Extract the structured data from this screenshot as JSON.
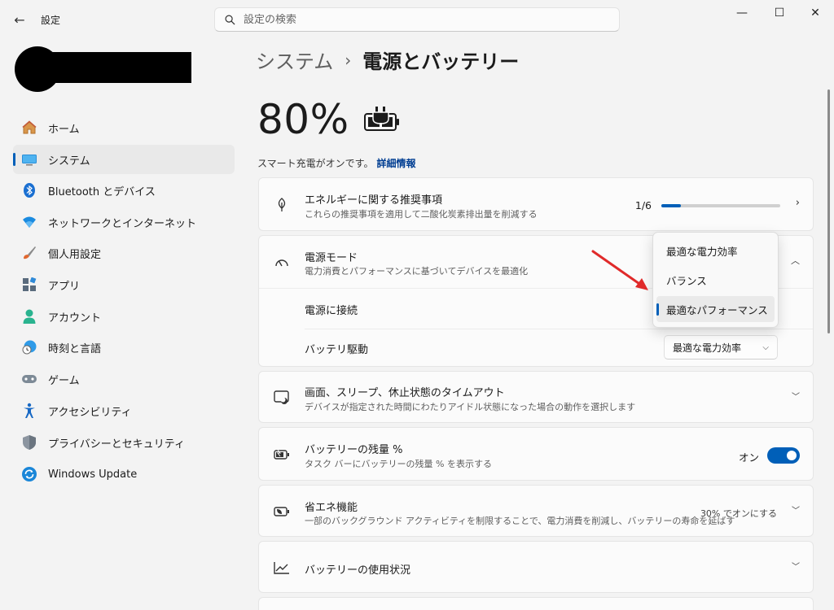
{
  "window": {
    "title": "設定",
    "back_icon": "←",
    "minimize_icon": "—",
    "maximize_icon": "☐",
    "close_icon": "✕"
  },
  "search": {
    "placeholder": "設定の検索"
  },
  "sidebar": {
    "items": [
      {
        "label": "ホーム",
        "icon": "home-icon",
        "active": false
      },
      {
        "label": "システム",
        "icon": "system-icon",
        "active": true
      },
      {
        "label": "Bluetooth とデバイス",
        "icon": "bluetooth-icon",
        "active": false
      },
      {
        "label": "ネットワークとインターネット",
        "icon": "wifi-icon",
        "active": false
      },
      {
        "label": "個人用設定",
        "icon": "brush-icon",
        "active": false
      },
      {
        "label": "アプリ",
        "icon": "apps-icon",
        "active": false
      },
      {
        "label": "アカウント",
        "icon": "account-icon",
        "active": false
      },
      {
        "label": "時刻と言語",
        "icon": "time-language-icon",
        "active": false
      },
      {
        "label": "ゲーム",
        "icon": "gamepad-icon",
        "active": false
      },
      {
        "label": "アクセシビリティ",
        "icon": "accessibility-icon",
        "active": false
      },
      {
        "label": "プライバシーとセキュリティ",
        "icon": "shield-icon",
        "active": false
      },
      {
        "label": "Windows Update",
        "icon": "update-icon",
        "active": false
      }
    ]
  },
  "breadcrumb": {
    "parent": "システム",
    "separator": "›",
    "current": "電源とバッテリー"
  },
  "battery": {
    "percent": "80%",
    "smart_charging_text": "スマート充電がオンです。",
    "details_link": "詳細情報"
  },
  "energy_rec": {
    "title": "エネルギーに関する推奨事項",
    "desc": "これらの推奨事項を適用して二酸化炭素排出量を削減する",
    "count": "1/6",
    "progress_fraction": 0.167
  },
  "power_mode": {
    "title": "電源モード",
    "desc": "電力消費とパフォーマンスに基づいてデバイスを最適化",
    "plugged_label": "電源に接続",
    "battery_label": "バッテリ駆動",
    "battery_value": "最適な電力効率",
    "options": [
      "最適な電力効率",
      "バランス",
      "最適なパフォーマンス"
    ],
    "selected_option": "最適なパフォーマンス"
  },
  "screen_sleep": {
    "title": "画面、スリープ、休止状態のタイムアウト",
    "desc": "デバイスが指定された時間にわたりアイドル状態になった場合の動作を選択します"
  },
  "battery_percent": {
    "title": "バッテリーの残量 %",
    "desc": "タスク バーにバッテリーの残量 % を表示する",
    "toggle_label": "オン",
    "toggle_on": true
  },
  "energy_saver": {
    "title": "省エネ機能",
    "desc": "一部のバックグラウンド アクティビティを制限することで、電力消費を削減し、バッテリーの寿命を延ばす",
    "note": "30% でオンにする"
  },
  "battery_usage": {
    "title": "バッテリーの使用状況"
  },
  "colors": {
    "accent": "#005fb8",
    "annotation_arrow": "#e02a2a"
  }
}
